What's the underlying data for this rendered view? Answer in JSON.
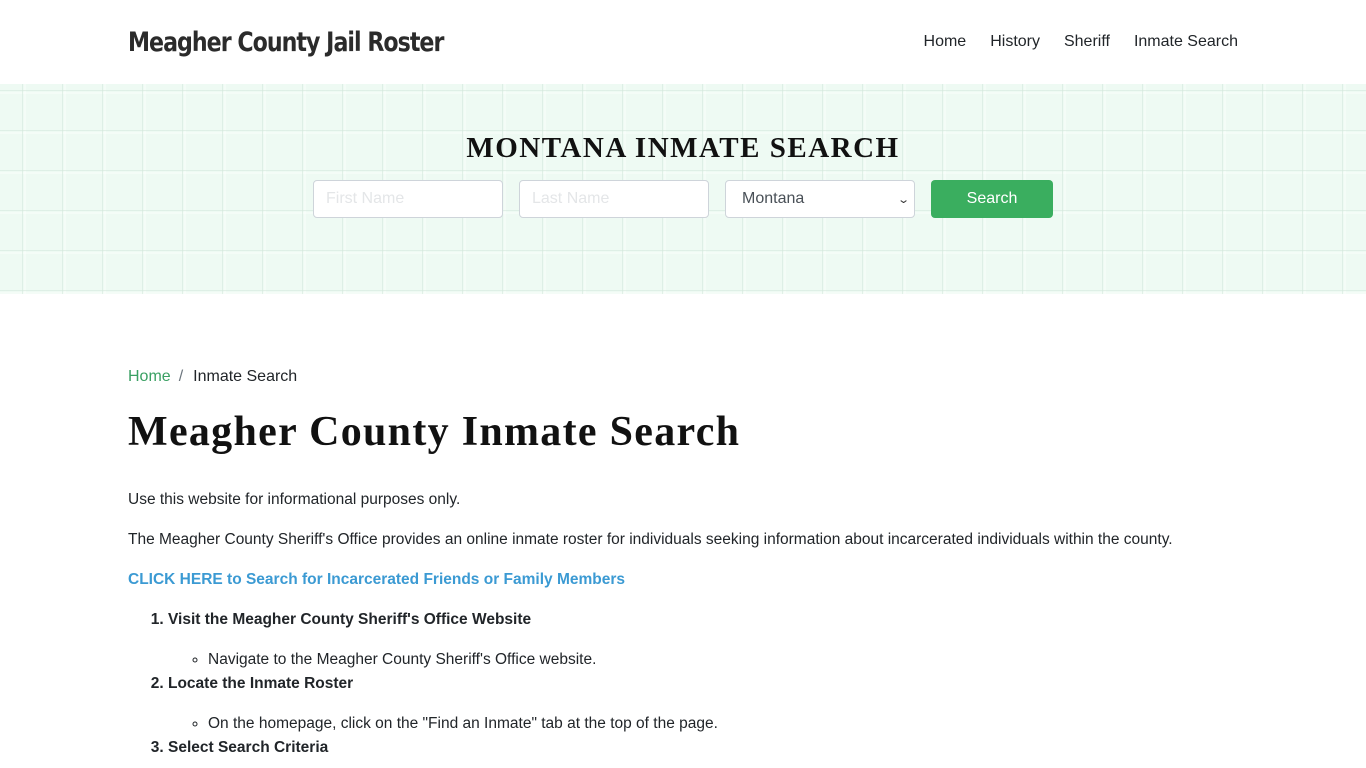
{
  "header": {
    "brand": "Meagher County Jail Roster",
    "nav": [
      {
        "label": "Home"
      },
      {
        "label": "History"
      },
      {
        "label": "Sheriff"
      },
      {
        "label": "Inmate Search"
      }
    ]
  },
  "hero": {
    "title": "MONTANA INMATE SEARCH",
    "first_name_placeholder": "First Name",
    "first_name_value": "",
    "last_name_placeholder": "Last Name",
    "last_name_value": "",
    "state_selected": "Montana",
    "search_label": "Search"
  },
  "breadcrumb": {
    "home": "Home",
    "separator": "/",
    "current": "Inmate Search"
  },
  "main": {
    "title": "Meagher County Inmate Search",
    "paragraphs": [
      "Use this website for informational purposes only.",
      "The Meagher County Sheriff's Office provides an online inmate roster for individuals seeking information about incarcerated individuals within the county."
    ],
    "cta": "CLICK HERE to Search for Incarcerated Friends or Family Members",
    "steps": [
      {
        "title": "Visit the Meagher County Sheriff's Office Website",
        "detail": "Navigate to the Meagher County Sheriff's Office website."
      },
      {
        "title": "Locate the Inmate Roster",
        "detail": "On the homepage, click on the \"Find an Inmate\" tab at the top of the page."
      },
      {
        "title": "Select Search Criteria"
      }
    ]
  },
  "colors": {
    "accent_green": "#3aae5f",
    "link_green": "#3aa063",
    "link_blue": "#3b9ad3",
    "hero_bg": "#eefaf3"
  }
}
